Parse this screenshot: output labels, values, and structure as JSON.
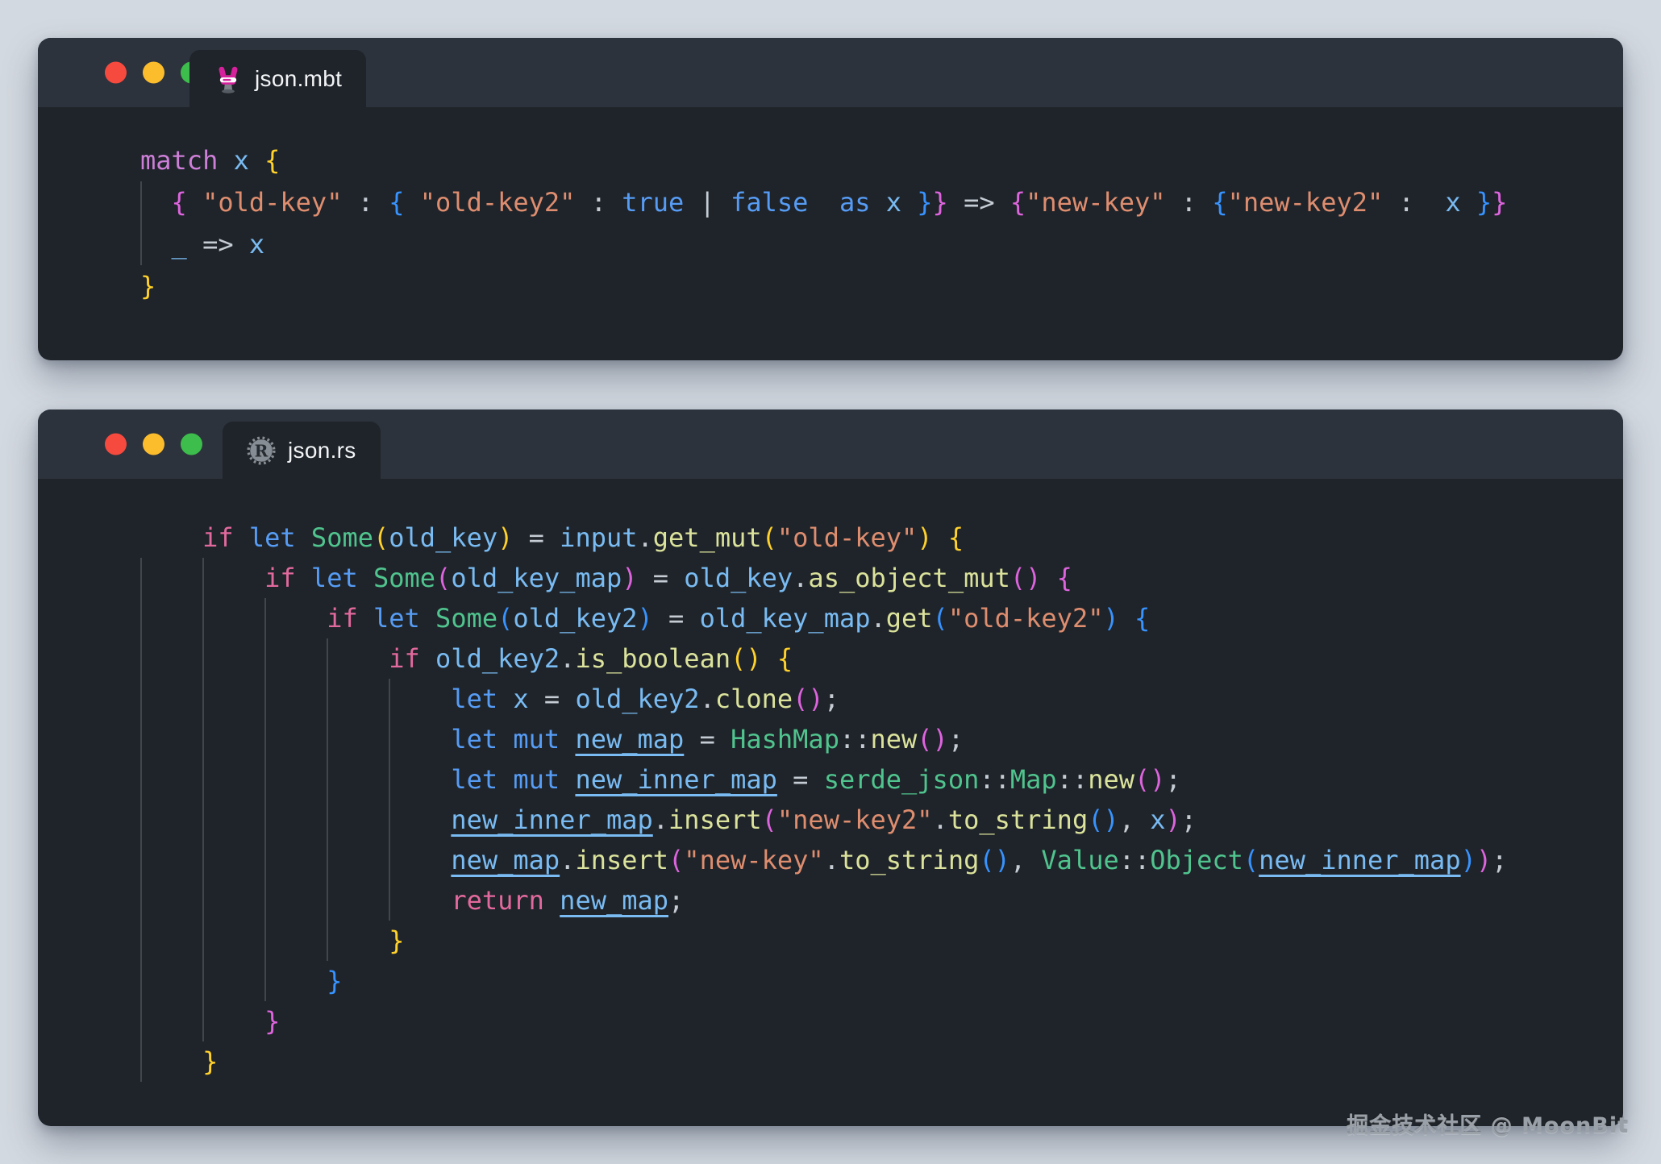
{
  "colors": {
    "match": "#cd7fd8",
    "kw": "#e2699d",
    "kw2": "#569cf5",
    "ident": "#79bbf2",
    "fn": "#dbe29b",
    "type": "#50c48e",
    "str": "#de8d6f",
    "punct": "#c6ccd4",
    "b1": "#ffd12b",
    "b2": "#de64de",
    "b3": "#3793ff",
    "guide": "#41464d"
  },
  "watermark": "掘金技术社区 @ MoonBit",
  "windows": [
    {
      "tab": {
        "label": "json.mbt",
        "icon": "moonbit-icon"
      },
      "guides": [
        {
          "col": 0,
          "from": 1,
          "to": 2
        }
      ],
      "lines": [
        [
          {
            "t": "match",
            "c": "match"
          },
          {
            "t": " ",
            "c": "punct"
          },
          {
            "t": "x",
            "c": "ident"
          },
          {
            "t": " ",
            "c": "punct"
          },
          {
            "t": "{",
            "c": "b1"
          }
        ],
        [
          {
            "t": "  ",
            "c": "punct"
          },
          {
            "t": "{",
            "c": "b2"
          },
          {
            "t": " ",
            "c": "punct"
          },
          {
            "t": "\"old-key\"",
            "c": "str"
          },
          {
            "t": " : ",
            "c": "punct"
          },
          {
            "t": "{",
            "c": "b3"
          },
          {
            "t": " ",
            "c": "punct"
          },
          {
            "t": "\"old-key2\"",
            "c": "str"
          },
          {
            "t": " : ",
            "c": "punct"
          },
          {
            "t": "true",
            "c": "kw2"
          },
          {
            "t": " | ",
            "c": "punct"
          },
          {
            "t": "false",
            "c": "kw2"
          },
          {
            "t": "  ",
            "c": "punct"
          },
          {
            "t": "as",
            "c": "kw2"
          },
          {
            "t": " ",
            "c": "punct"
          },
          {
            "t": "x",
            "c": "ident"
          },
          {
            "t": " ",
            "c": "punct"
          },
          {
            "t": "}",
            "c": "b3"
          },
          {
            "t": "}",
            "c": "b2"
          },
          {
            "t": " => ",
            "c": "punct"
          },
          {
            "t": "{",
            "c": "b2"
          },
          {
            "t": "\"new-key\"",
            "c": "str"
          },
          {
            "t": " : ",
            "c": "punct"
          },
          {
            "t": "{",
            "c": "b3"
          },
          {
            "t": "\"new-key2\"",
            "c": "str"
          },
          {
            "t": " :  ",
            "c": "punct"
          },
          {
            "t": "x",
            "c": "ident"
          },
          {
            "t": " ",
            "c": "punct"
          },
          {
            "t": "}",
            "c": "b3"
          },
          {
            "t": "}",
            "c": "b2"
          }
        ],
        [
          {
            "t": "  ",
            "c": "punct"
          },
          {
            "t": "_",
            "c": "ident"
          },
          {
            "t": " => ",
            "c": "punct"
          },
          {
            "t": "x",
            "c": "ident"
          }
        ],
        [
          {
            "t": "}",
            "c": "b1"
          }
        ]
      ]
    },
    {
      "tab": {
        "label": "json.rs",
        "icon": "rust-icon"
      },
      "guides": [
        {
          "col": 0,
          "from": 1,
          "to": 13
        },
        {
          "col": 4,
          "from": 1,
          "to": 12
        },
        {
          "col": 8,
          "from": 2,
          "to": 11
        },
        {
          "col": 12,
          "from": 3,
          "to": 10
        },
        {
          "col": 16,
          "from": 4,
          "to": 9
        }
      ],
      "lines": [
        [
          {
            "t": "    ",
            "c": "punct"
          },
          {
            "t": "if",
            "c": "kw"
          },
          {
            "t": " ",
            "c": "punct"
          },
          {
            "t": "let",
            "c": "kw2"
          },
          {
            "t": " ",
            "c": "punct"
          },
          {
            "t": "Some",
            "c": "type"
          },
          {
            "t": "(",
            "c": "b1"
          },
          {
            "t": "old_key",
            "c": "ident"
          },
          {
            "t": ")",
            "c": "b1"
          },
          {
            "t": " = ",
            "c": "punct"
          },
          {
            "t": "input",
            "c": "ident"
          },
          {
            "t": ".",
            "c": "punct"
          },
          {
            "t": "get_mut",
            "c": "fn"
          },
          {
            "t": "(",
            "c": "b1"
          },
          {
            "t": "\"old-key\"",
            "c": "str"
          },
          {
            "t": ")",
            "c": "b1"
          },
          {
            "t": " ",
            "c": "punct"
          },
          {
            "t": "{",
            "c": "b1"
          }
        ],
        [
          {
            "t": "        ",
            "c": "punct"
          },
          {
            "t": "if",
            "c": "kw"
          },
          {
            "t": " ",
            "c": "punct"
          },
          {
            "t": "let",
            "c": "kw2"
          },
          {
            "t": " ",
            "c": "punct"
          },
          {
            "t": "Some",
            "c": "type"
          },
          {
            "t": "(",
            "c": "b2"
          },
          {
            "t": "old_key_map",
            "c": "ident"
          },
          {
            "t": ")",
            "c": "b2"
          },
          {
            "t": " = ",
            "c": "punct"
          },
          {
            "t": "old_key",
            "c": "ident"
          },
          {
            "t": ".",
            "c": "punct"
          },
          {
            "t": "as_object_mut",
            "c": "fn"
          },
          {
            "t": "(",
            "c": "b2"
          },
          {
            "t": ")",
            "c": "b2"
          },
          {
            "t": " ",
            "c": "punct"
          },
          {
            "t": "{",
            "c": "b2"
          }
        ],
        [
          {
            "t": "            ",
            "c": "punct"
          },
          {
            "t": "if",
            "c": "kw"
          },
          {
            "t": " ",
            "c": "punct"
          },
          {
            "t": "let",
            "c": "kw2"
          },
          {
            "t": " ",
            "c": "punct"
          },
          {
            "t": "Some",
            "c": "type"
          },
          {
            "t": "(",
            "c": "b3"
          },
          {
            "t": "old_key2",
            "c": "ident"
          },
          {
            "t": ")",
            "c": "b3"
          },
          {
            "t": " = ",
            "c": "punct"
          },
          {
            "t": "old_key_map",
            "c": "ident"
          },
          {
            "t": ".",
            "c": "punct"
          },
          {
            "t": "get",
            "c": "fn"
          },
          {
            "t": "(",
            "c": "b3"
          },
          {
            "t": "\"old-key2\"",
            "c": "str"
          },
          {
            "t": ")",
            "c": "b3"
          },
          {
            "t": " ",
            "c": "punct"
          },
          {
            "t": "{",
            "c": "b3"
          }
        ],
        [
          {
            "t": "                ",
            "c": "punct"
          },
          {
            "t": "if",
            "c": "kw"
          },
          {
            "t": " ",
            "c": "punct"
          },
          {
            "t": "old_key2",
            "c": "ident"
          },
          {
            "t": ".",
            "c": "punct"
          },
          {
            "t": "is_boolean",
            "c": "fn"
          },
          {
            "t": "(",
            "c": "b1"
          },
          {
            "t": ")",
            "c": "b1"
          },
          {
            "t": " ",
            "c": "punct"
          },
          {
            "t": "{",
            "c": "b1"
          }
        ],
        [
          {
            "t": "                    ",
            "c": "punct"
          },
          {
            "t": "let",
            "c": "kw2"
          },
          {
            "t": " ",
            "c": "punct"
          },
          {
            "t": "x",
            "c": "ident"
          },
          {
            "t": " = ",
            "c": "punct"
          },
          {
            "t": "old_key2",
            "c": "ident"
          },
          {
            "t": ".",
            "c": "punct"
          },
          {
            "t": "clone",
            "c": "fn"
          },
          {
            "t": "(",
            "c": "b2"
          },
          {
            "t": ")",
            "c": "b2"
          },
          {
            "t": ";",
            "c": "punct"
          }
        ],
        [
          {
            "t": "                    ",
            "c": "punct"
          },
          {
            "t": "let",
            "c": "kw2"
          },
          {
            "t": " ",
            "c": "punct"
          },
          {
            "t": "mut",
            "c": "kw2"
          },
          {
            "t": " ",
            "c": "punct"
          },
          {
            "t": "new_map",
            "c": "ident",
            "u": true
          },
          {
            "t": " = ",
            "c": "punct"
          },
          {
            "t": "HashMap",
            "c": "type"
          },
          {
            "t": "::",
            "c": "punct"
          },
          {
            "t": "new",
            "c": "fn"
          },
          {
            "t": "(",
            "c": "b2"
          },
          {
            "t": ")",
            "c": "b2"
          },
          {
            "t": ";",
            "c": "punct"
          }
        ],
        [
          {
            "t": "                    ",
            "c": "punct"
          },
          {
            "t": "let",
            "c": "kw2"
          },
          {
            "t": " ",
            "c": "punct"
          },
          {
            "t": "mut",
            "c": "kw2"
          },
          {
            "t": " ",
            "c": "punct"
          },
          {
            "t": "new_inner_map",
            "c": "ident",
            "u": true
          },
          {
            "t": " = ",
            "c": "punct"
          },
          {
            "t": "serde_json",
            "c": "type"
          },
          {
            "t": "::",
            "c": "punct"
          },
          {
            "t": "Map",
            "c": "type"
          },
          {
            "t": "::",
            "c": "punct"
          },
          {
            "t": "new",
            "c": "fn"
          },
          {
            "t": "(",
            "c": "b2"
          },
          {
            "t": ")",
            "c": "b2"
          },
          {
            "t": ";",
            "c": "punct"
          }
        ],
        [
          {
            "t": "                    ",
            "c": "punct"
          },
          {
            "t": "new_inner_map",
            "c": "ident",
            "u": true
          },
          {
            "t": ".",
            "c": "punct"
          },
          {
            "t": "insert",
            "c": "fn"
          },
          {
            "t": "(",
            "c": "b2"
          },
          {
            "t": "\"new-key2\"",
            "c": "str"
          },
          {
            "t": ".",
            "c": "punct"
          },
          {
            "t": "to_string",
            "c": "fn"
          },
          {
            "t": "(",
            "c": "b3"
          },
          {
            "t": ")",
            "c": "b3"
          },
          {
            "t": ", ",
            "c": "punct"
          },
          {
            "t": "x",
            "c": "ident"
          },
          {
            "t": ")",
            "c": "b2"
          },
          {
            "t": ";",
            "c": "punct"
          }
        ],
        [
          {
            "t": "                    ",
            "c": "punct"
          },
          {
            "t": "new_map",
            "c": "ident",
            "u": true
          },
          {
            "t": ".",
            "c": "punct"
          },
          {
            "t": "insert",
            "c": "fn"
          },
          {
            "t": "(",
            "c": "b2"
          },
          {
            "t": "\"new-key\"",
            "c": "str"
          },
          {
            "t": ".",
            "c": "punct"
          },
          {
            "t": "to_string",
            "c": "fn"
          },
          {
            "t": "(",
            "c": "b3"
          },
          {
            "t": ")",
            "c": "b3"
          },
          {
            "t": ", ",
            "c": "punct"
          },
          {
            "t": "Value",
            "c": "type"
          },
          {
            "t": "::",
            "c": "punct"
          },
          {
            "t": "Object",
            "c": "type"
          },
          {
            "t": "(",
            "c": "b3"
          },
          {
            "t": "new_inner_map",
            "c": "ident",
            "u": true
          },
          {
            "t": ")",
            "c": "b3"
          },
          {
            "t": ")",
            "c": "b2"
          },
          {
            "t": ";",
            "c": "punct"
          }
        ],
        [
          {
            "t": "                    ",
            "c": "punct"
          },
          {
            "t": "return",
            "c": "kw"
          },
          {
            "t": " ",
            "c": "punct"
          },
          {
            "t": "new_map",
            "c": "ident",
            "u": true
          },
          {
            "t": ";",
            "c": "punct"
          }
        ],
        [
          {
            "t": "                ",
            "c": "punct"
          },
          {
            "t": "}",
            "c": "b1"
          }
        ],
        [
          {
            "t": "            ",
            "c": "punct"
          },
          {
            "t": "}",
            "c": "b3"
          }
        ],
        [
          {
            "t": "        ",
            "c": "punct"
          },
          {
            "t": "}",
            "c": "b2"
          }
        ],
        [
          {
            "t": "    ",
            "c": "punct"
          },
          {
            "t": "}",
            "c": "b1"
          }
        ]
      ]
    }
  ]
}
